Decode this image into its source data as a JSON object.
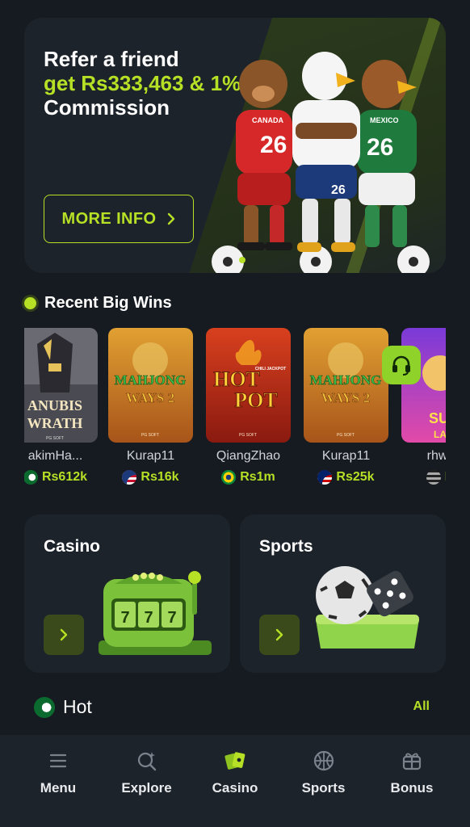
{
  "banner": {
    "line1": "Refer a friend",
    "line2": "get Rs333,463 & 1%",
    "line3": "Commission",
    "cta": "MORE INFO",
    "cta_icon": "chevron-right-icon",
    "mascots": [
      "beaver-mascot",
      "eagle-mascot",
      "hawk-mascot"
    ],
    "jerseys": [
      "26",
      "26",
      "26"
    ],
    "jersey_names": [
      "CANADA",
      "MEXICO"
    ]
  },
  "recent_wins": {
    "title": "Recent Big Wins",
    "items": [
      {
        "game": "ANUBIS WRATH",
        "game_line1": "ANUBIS",
        "game_line2": "WRATH",
        "provider": "PG SOFT",
        "user": "akimHa...",
        "amount": "Rs612k",
        "flag": "pakistan-flag",
        "theme": "#4a4a52"
      },
      {
        "game": "MAHJONG WAYS 2",
        "game_line1": "MAHJONG",
        "game_line2": "WAYS 2",
        "provider": "PG SOFT",
        "user": "Kurap11",
        "amount": "Rs16k",
        "flag": "usa-flag",
        "theme": "#c7781d"
      },
      {
        "game": "HOT POT",
        "game_line1": "HOT",
        "game_line2": "POT",
        "provider": "PG SOFT",
        "badge": "CHILI JACKPOT",
        "user": "QiangZhao",
        "amount": "Rs1m",
        "flag": "brazil-flag",
        "theme": "#b22a18"
      },
      {
        "game": "MAHJONG WAYS 2",
        "game_line1": "MAHJONG",
        "game_line2": "WAYS 2",
        "provider": "PG SOFT",
        "user": "Kurap11",
        "amount": "Rs25k",
        "flag": "malaysia-flag",
        "theme": "#c7781d"
      },
      {
        "game": "SUGAR LAND",
        "game_line1": "SUG",
        "game_line2": "LA",
        "provider": "",
        "user": "rhwxv",
        "amount": "Rs",
        "flag": "generic-flag",
        "theme": "#c43fa8"
      }
    ]
  },
  "support": {
    "icon": "headset-icon"
  },
  "categories": {
    "casino": {
      "label": "Casino",
      "icon": "slot-machine-icon",
      "reels": "777"
    },
    "sports": {
      "label": "Sports",
      "icon": "soccer-dice-icon"
    }
  },
  "hot": {
    "title": "Hot",
    "flag": "pakistan-flag",
    "all_label": "All"
  },
  "nav": [
    {
      "label": "Menu",
      "icon": "menu-icon",
      "active": false
    },
    {
      "label": "Explore",
      "icon": "explore-icon",
      "active": false
    },
    {
      "label": "Casino",
      "icon": "cards-icon",
      "active": true
    },
    {
      "label": "Sports",
      "icon": "basketball-icon",
      "active": false
    },
    {
      "label": "Bonus",
      "icon": "gift-icon",
      "active": false
    }
  ],
  "colors": {
    "accent": "#b6e025",
    "background": "#161b21",
    "card": "#1d232b"
  }
}
